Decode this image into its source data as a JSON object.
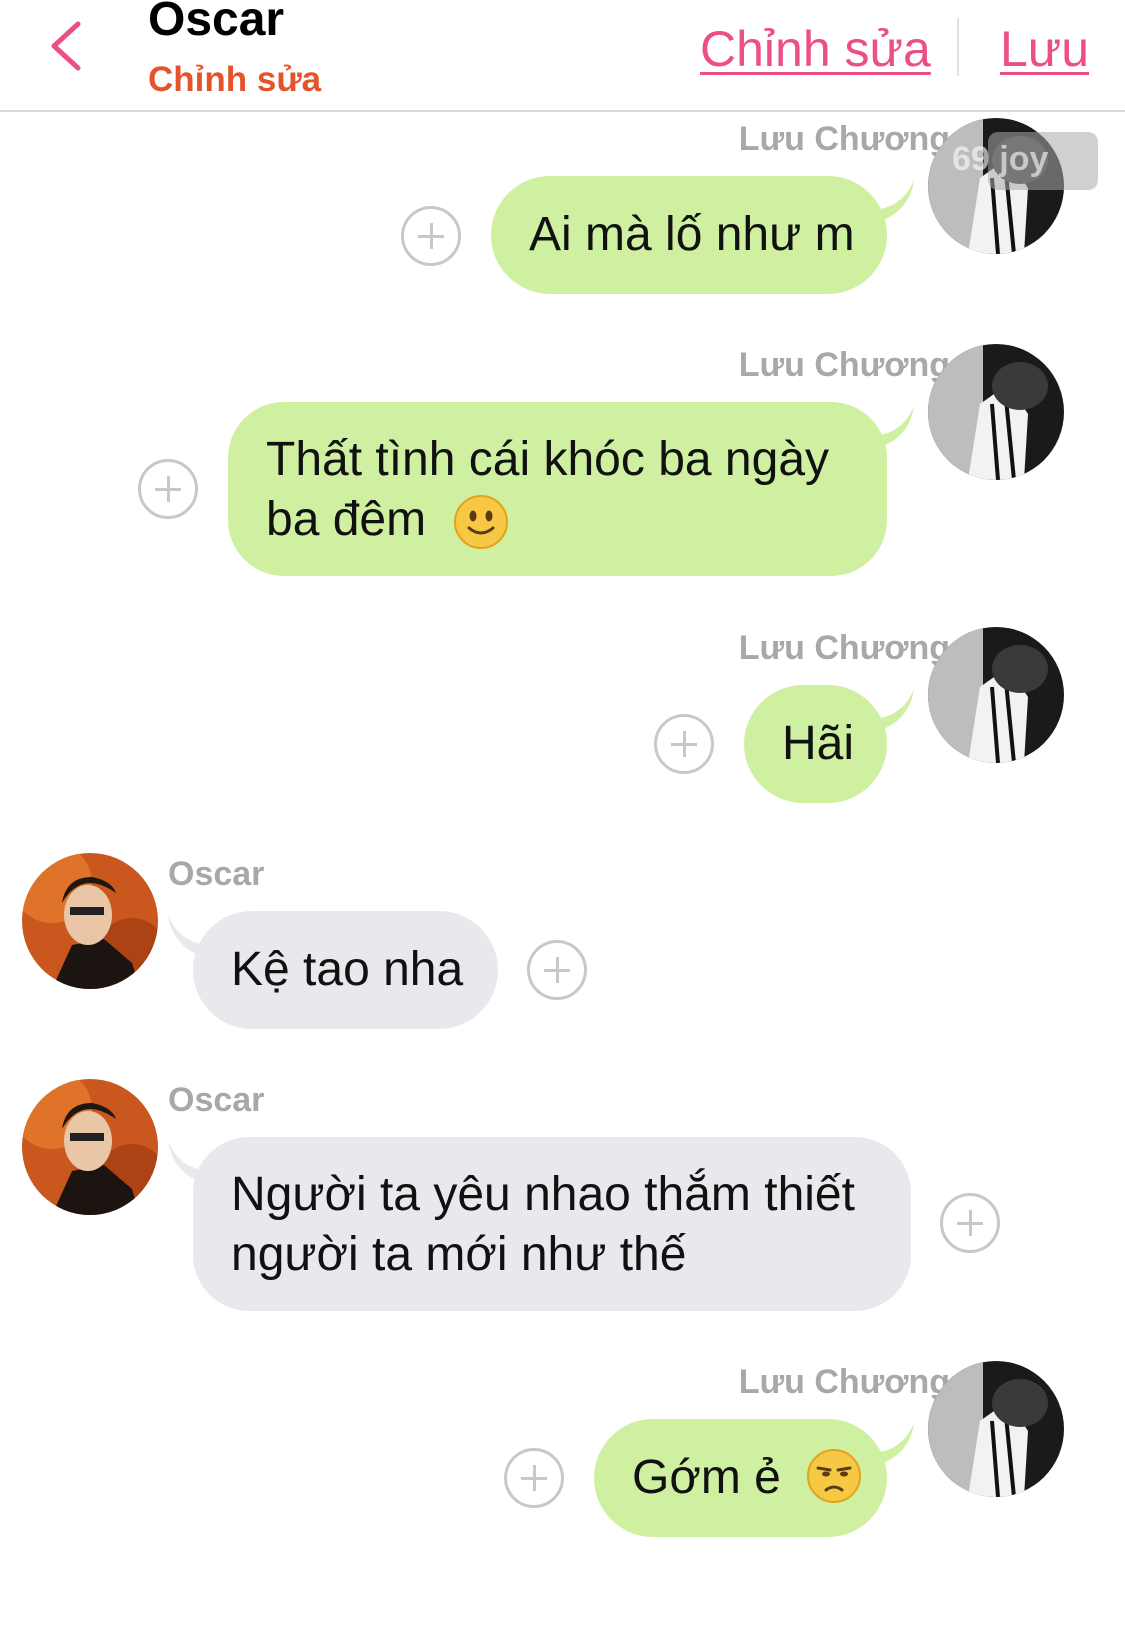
{
  "header": {
    "back_icon": "chevron-left-icon",
    "title": "Oscar",
    "subtitle": "Chỉnh sửa",
    "edit_label": "Chỉnh sửa",
    "save_label": "Lưu"
  },
  "colors": {
    "accent": "#ec4f88",
    "subtitle": "#e5532b",
    "bubble_me": "#cff0a0",
    "bubble_other": "#e7e9ec",
    "sender_name": "#a8a8a8"
  },
  "watermark": "69 joy",
  "messages": [
    {
      "sender": "Lưu Chương",
      "line1": "Ai mà lố như m"
    },
    {
      "sender": "Lưu Chương",
      "line1": "Thất tình cái khóc ba ngày",
      "line2": "ba đêm",
      "emoji": "slightly-smiling-face"
    },
    {
      "sender": "Lưu Chương",
      "line1": "Hãi"
    },
    {
      "sender": "Oscar",
      "line1": "Kệ tao nha"
    },
    {
      "sender": "Oscar",
      "line1": "Người ta yêu nhao thắm thiết",
      "line2": "người ta mới như thế"
    },
    {
      "sender": "Lưu Chương",
      "line1": "Gớm ẻ",
      "emoji": "unamused-face"
    }
  ]
}
